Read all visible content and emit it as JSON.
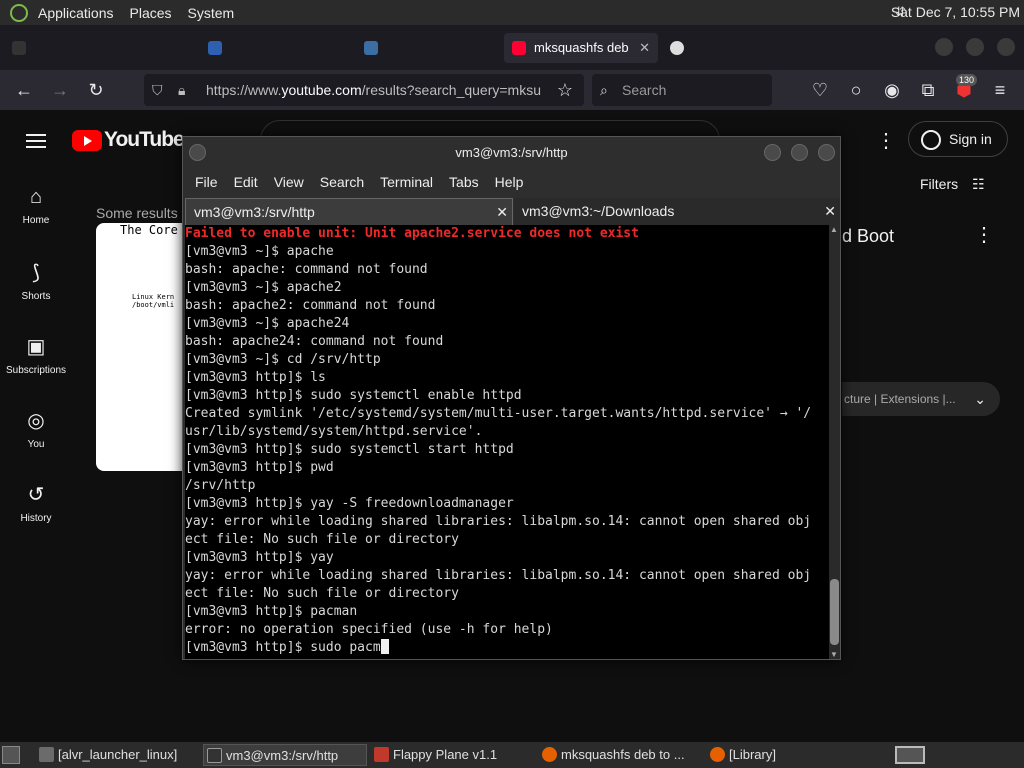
{
  "top_panel": {
    "menus": [
      "Applications",
      "Places",
      "System"
    ],
    "clock": "Sat Dec  7, 10:55 PM"
  },
  "browser": {
    "tabs": [
      {
        "label": "mksquashfs deb",
        "active": true,
        "favicon_color": "#ff0033"
      }
    ],
    "url_prefix": "https://www.",
    "url_domain": "youtube.com",
    "url_rest": "/results?search_query=mksu",
    "search_placeholder": "Search",
    "extension_badge": "130"
  },
  "youtube": {
    "logo_text": "YouTube",
    "sign_in_label": "Sign in",
    "filters_label": "Filters",
    "some_results_label": "Some results",
    "sidebar": [
      {
        "label": "Home",
        "icon": "home-icon"
      },
      {
        "label": "Shorts",
        "icon": "shorts-icon"
      },
      {
        "label": "Subscriptions",
        "icon": "subscriptions-icon"
      },
      {
        "label": "You",
        "icon": "you-icon"
      },
      {
        "label": "History",
        "icon": "history-icon"
      }
    ],
    "thumbnail_title": "The Core",
    "thumbnail_text_1": "Linux Kern",
    "thumbnail_text_2": "/boot/vmli",
    "video_title_fragment": "d Boot",
    "chip_text": "cture | Extensions |..."
  },
  "terminal": {
    "window_title": "vm3@vm3:/srv/http",
    "menu": [
      "File",
      "Edit",
      "View",
      "Search",
      "Terminal",
      "Tabs",
      "Help"
    ],
    "tabs": [
      "vm3@vm3:/srv/http",
      "vm3@vm3:~/Downloads"
    ],
    "lines": [
      {
        "text": "Failed to enable unit: Unit apache2.service does not exist",
        "error": true
      },
      {
        "text": "[vm3@vm3 ~]$ apache"
      },
      {
        "text": "bash: apache: command not found"
      },
      {
        "text": "[vm3@vm3 ~]$ apache2"
      },
      {
        "text": "bash: apache2: command not found"
      },
      {
        "text": "[vm3@vm3 ~]$ apache24"
      },
      {
        "text": "bash: apache24: command not found"
      },
      {
        "text": "[vm3@vm3 ~]$ cd /srv/http"
      },
      {
        "text": "[vm3@vm3 http]$ ls"
      },
      {
        "text": "[vm3@vm3 http]$ sudo systemctl enable httpd"
      },
      {
        "text": "Created symlink '/etc/systemd/system/multi-user.target.wants/httpd.service' → '/"
      },
      {
        "text": "usr/lib/systemd/system/httpd.service'."
      },
      {
        "text": "[vm3@vm3 http]$ sudo systemctl start httpd"
      },
      {
        "text": "[vm3@vm3 http]$ pwd"
      },
      {
        "text": "/srv/http"
      },
      {
        "text": "[vm3@vm3 http]$ yay -S freedownloadmanager"
      },
      {
        "text": "yay: error while loading shared libraries: libalpm.so.14: cannot open shared obj"
      },
      {
        "text": "ect file: No such file or directory"
      },
      {
        "text": "[vm3@vm3 http]$ yay"
      },
      {
        "text": "yay: error while loading shared libraries: libalpm.so.14: cannot open shared obj"
      },
      {
        "text": "ect file: No such file or directory"
      },
      {
        "text": "[vm3@vm3 http]$ pacman"
      },
      {
        "text": "error: no operation specified (use -h for help)"
      }
    ],
    "current_input": "[vm3@vm3 http]$ sudo pacm"
  },
  "taskbar": {
    "items": [
      {
        "label": "[alvr_launcher_linux]",
        "icon": "folder-icon",
        "color": "#6b6b6b"
      },
      {
        "label": "vm3@vm3:/srv/http",
        "icon": "terminal-icon",
        "color": "#333333",
        "active": true
      },
      {
        "label": "Flappy Plane v1.1",
        "icon": "game-icon",
        "color": "#c0392b"
      },
      {
        "label": "mksquashfs deb to ...",
        "icon": "firefox-icon",
        "color": "#e66000"
      },
      {
        "label": "[Library]",
        "icon": "firefox-icon",
        "color": "#e66000"
      }
    ]
  },
  "colors": {
    "youtube_red": "#ff0000",
    "terminal_error": "#ef2929",
    "terminal_bg": "#000000"
  }
}
